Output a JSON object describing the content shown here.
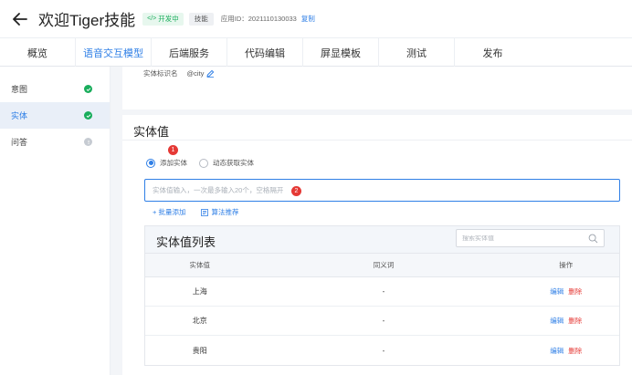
{
  "header": {
    "title": "欢迎Tiger技能",
    "status_badge": "开发中",
    "status_icon": "</>",
    "type_badge": "技能",
    "app_id": "应用ID：2021110130033",
    "copy_label": "复制"
  },
  "tabs": [
    {
      "label": "概览"
    },
    {
      "label": "语音交互模型",
      "active": true
    },
    {
      "label": "后端服务"
    },
    {
      "label": "代码编辑"
    },
    {
      "label": "屏显模板"
    },
    {
      "label": "测试"
    },
    {
      "label": "发布"
    }
  ],
  "sidebar": {
    "items": [
      {
        "label": "意图",
        "status": "complete"
      },
      {
        "label": "实体",
        "status": "complete",
        "active": true
      },
      {
        "label": "问答",
        "status": "pending"
      }
    ]
  },
  "entity_info": {
    "label": "实体标识名",
    "value": "@city"
  },
  "entity_values": {
    "title": "实体值",
    "radio_add": "添加实体",
    "radio_dynamic": "动态获取实体",
    "step1": "1",
    "step2": "2",
    "input_placeholder": "实体值输入，一次最多输入20个，空格隔开",
    "batch_add": "+ 批量添加",
    "algo_recommend": "算法推荐"
  },
  "table": {
    "title": "实体值列表",
    "search_placeholder": "搜索实体值",
    "columns": [
      "实体值",
      "同义词",
      "操作"
    ],
    "rows": [
      {
        "value": "上海",
        "synonym": "-",
        "edit": "编辑",
        "delete": "删除"
      },
      {
        "value": "北京",
        "synonym": "-",
        "edit": "编辑",
        "delete": "删除"
      },
      {
        "value": "贵阳",
        "synonym": "-",
        "edit": "编辑",
        "delete": "删除"
      }
    ]
  },
  "colors": {
    "accent": "#2f7fe6",
    "success": "#1aad5c",
    "danger": "#e53935"
  }
}
